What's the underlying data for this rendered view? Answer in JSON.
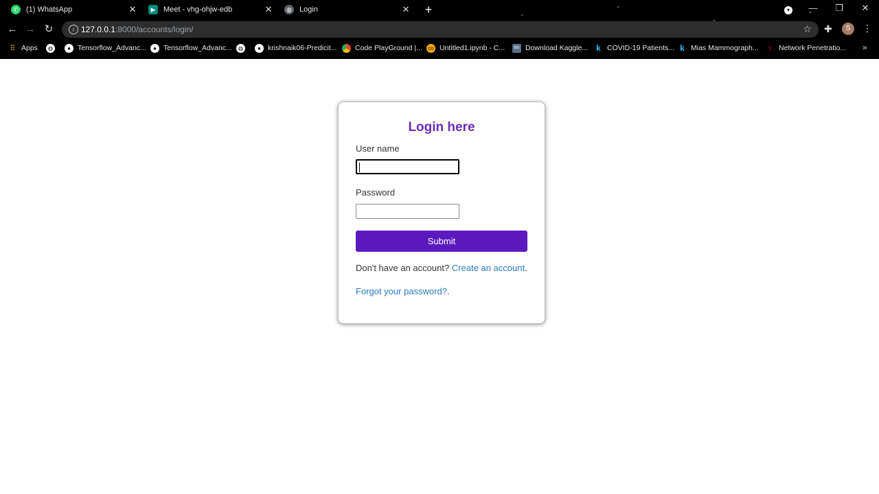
{
  "browser": {
    "tabs": [
      {
        "title": "(1) WhatsApp",
        "icon": "whatsapp-icon",
        "color": "#25d366",
        "close": "✕"
      },
      {
        "title": "Meet - vhg-ohjw-edb",
        "icon": "meet-icon",
        "color": "#00897b",
        "close": "✕"
      },
      {
        "title": "Login",
        "icon": "globe-icon",
        "color": "#5f6368",
        "close": "✕"
      }
    ],
    "new_tab": "+",
    "url_host": "127.0.0.1",
    "url_rest": ":8000/accounts/login/",
    "profile_initial": "S",
    "bookmarks": [
      {
        "label": "Apps",
        "icon": "apps-grid-icon"
      },
      {
        "label": "",
        "icon": "globe-icon"
      },
      {
        "label": "Tensorflow_Advanc...",
        "icon": "github-icon"
      },
      {
        "label": "Tensorflow_Advanc...",
        "icon": "github-icon"
      },
      {
        "label": "",
        "icon": "globe-icon"
      },
      {
        "label": "krishnaik06-Predicit...",
        "icon": "github-icon"
      },
      {
        "label": "Code PlayGround |...",
        "icon": "chrome-icon"
      },
      {
        "label": "Untitled1.ipynb - C...",
        "icon": "colab-icon"
      },
      {
        "label": "Download Kaggle...",
        "icon": "kaggle-icon"
      },
      {
        "label": "COVID-19 Patients...",
        "icon": "kaggle-k-icon"
      },
      {
        "label": "Mias Mammograph...",
        "icon": "kaggle-k-icon"
      },
      {
        "label": "Network Penetratio...",
        "icon": "kali-icon"
      }
    ],
    "bookmarks_more": "»"
  },
  "login": {
    "title": "Login here",
    "username_label": "User name",
    "username_value": "",
    "password_label": "Password",
    "password_value": "",
    "submit_label": "Submit",
    "no_account_text": "Don't have an account?",
    "create_account_link": "Create an account",
    "forgot_link": "Forgot your password?",
    "period": "."
  },
  "colors": {
    "title": "#6b2bb8",
    "button": "#5b1ac0",
    "link": "#2a7ac4"
  }
}
